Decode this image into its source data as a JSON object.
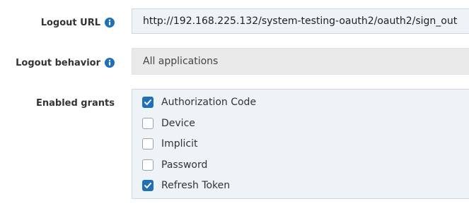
{
  "logout_url": {
    "label": "Logout URL",
    "value": "http://192.168.225.132/system-testing-oauth2/oauth2/sign_out"
  },
  "logout_behavior": {
    "label": "Logout behavior",
    "value": "All applications"
  },
  "enabled_grants": {
    "label": "Enabled grants",
    "options": [
      {
        "label": "Authorization Code",
        "checked": true
      },
      {
        "label": "Device",
        "checked": false
      },
      {
        "label": "Implicit",
        "checked": false
      },
      {
        "label": "Password",
        "checked": false
      },
      {
        "label": "Refresh Token",
        "checked": true
      }
    ]
  },
  "colors": {
    "accent": "#1f6fb9",
    "info_icon": "#1f6fb9",
    "field_bg": "#eef3f8",
    "select_bg": "#eaeaea"
  },
  "icons": {
    "info": "info-icon",
    "check": "check-icon"
  }
}
